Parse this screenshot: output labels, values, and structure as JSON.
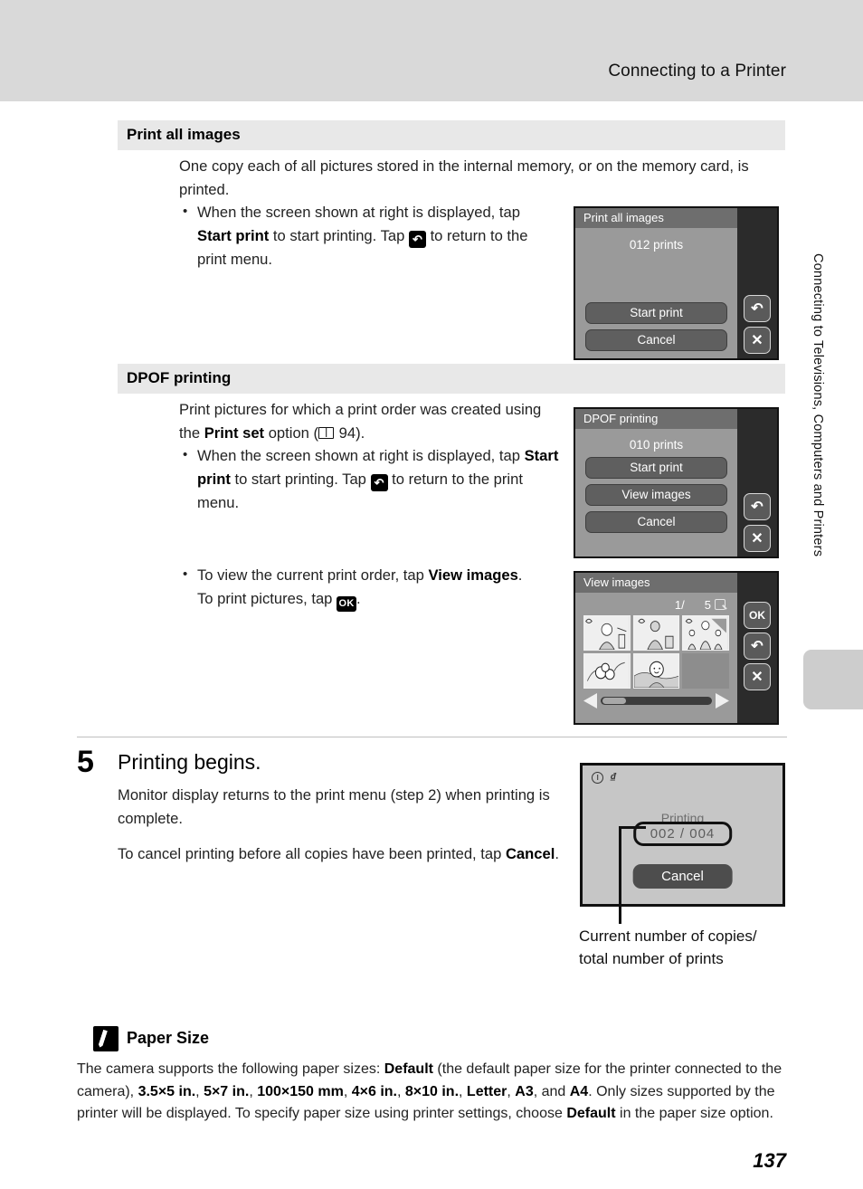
{
  "header": {
    "title": "Connecting to a Printer"
  },
  "side_tab": {
    "text": "Connecting to Televisions, Computers and Printers"
  },
  "page_number": "137",
  "sections": [
    {
      "heading": "Print all images",
      "intro": "One copy each of all pictures stored in the internal memory, or on the memory card, is printed.",
      "bullet_a": "When the screen shown at right is displayed, tap ",
      "bullet_a_bold": "Start print",
      "bullet_a_mid": " to start printing. Tap ",
      "bullet_a_end": " to return to the print menu."
    },
    {
      "heading": "DPOF printing",
      "intro_a": "Print pictures for which a print order was created using the ",
      "intro_bold": "Print set",
      "intro_b": " option (",
      "intro_page": " 94).",
      "bullet_a": "When the screen shown at right is displayed, tap ",
      "bullet_a_bold": "Start print",
      "bullet_a_mid": " to start printing. Tap ",
      "bullet_a_end": " to return to the print menu.",
      "bullet_b": "To view the current print order, tap ",
      "bullet_b_bold": "View images",
      "bullet_b_mid": ". To print pictures, tap ",
      "bullet_b_end": "."
    }
  ],
  "screens": {
    "print_all": {
      "title": "Print all images",
      "count": "012 prints",
      "buttons": [
        "Start print",
        "Cancel"
      ],
      "rail": [
        "return-icon",
        "close-icon"
      ]
    },
    "dpof": {
      "title": "DPOF printing",
      "count": "010 prints",
      "buttons": [
        "Start print",
        "View images",
        "Cancel"
      ],
      "rail": [
        "return-icon",
        "close-icon"
      ]
    },
    "view_images": {
      "title": "View images",
      "current": "1/",
      "total": "5",
      "rail": [
        "ok-icon",
        "return-icon",
        "close-icon"
      ]
    },
    "printing": {
      "status": "Printing",
      "counter": "002 / 004",
      "cancel": "Cancel",
      "icons": [
        "info-icon",
        "shake-icon"
      ]
    }
  },
  "step5": {
    "number": "5",
    "title": "Printing begins.",
    "para1": "Monitor display returns to the print menu (step 2) when printing is complete.",
    "para2_a": "To cancel printing before all copies have been printed, tap ",
    "para2_bold": "Cancel",
    "para2_end": "."
  },
  "caption": {
    "line1": "Current number of copies/",
    "line2": "total number of prints"
  },
  "note": {
    "title": "Paper Size",
    "t1": "The camera supports the following paper sizes: ",
    "b1": "Default",
    "t2": " (the default paper size for the printer connected to the camera), ",
    "b2": "3.5×5 in.",
    "t3": ", ",
    "b3": "5×7 in.",
    "t4": ", ",
    "b4": "100×150 mm",
    "t5": ", ",
    "b5": "4×6 in.",
    "t6": ", ",
    "b6": "8×10 in.",
    "t7": ", ",
    "b7": "Letter",
    "t8": ", ",
    "b8": "A3",
    "t9": ", and ",
    "b9": "A4",
    "t10": ". Only sizes supported by the printer will be displayed. To specify paper size using printer settings, choose ",
    "b10": "Default",
    "t11": " in the paper size option."
  },
  "colors": {
    "header_bar": "#d9d9d9",
    "section_bar": "#e8e8e8",
    "screen_body": "#9a9a9a",
    "screen_bezel": "#2b2b2b"
  }
}
